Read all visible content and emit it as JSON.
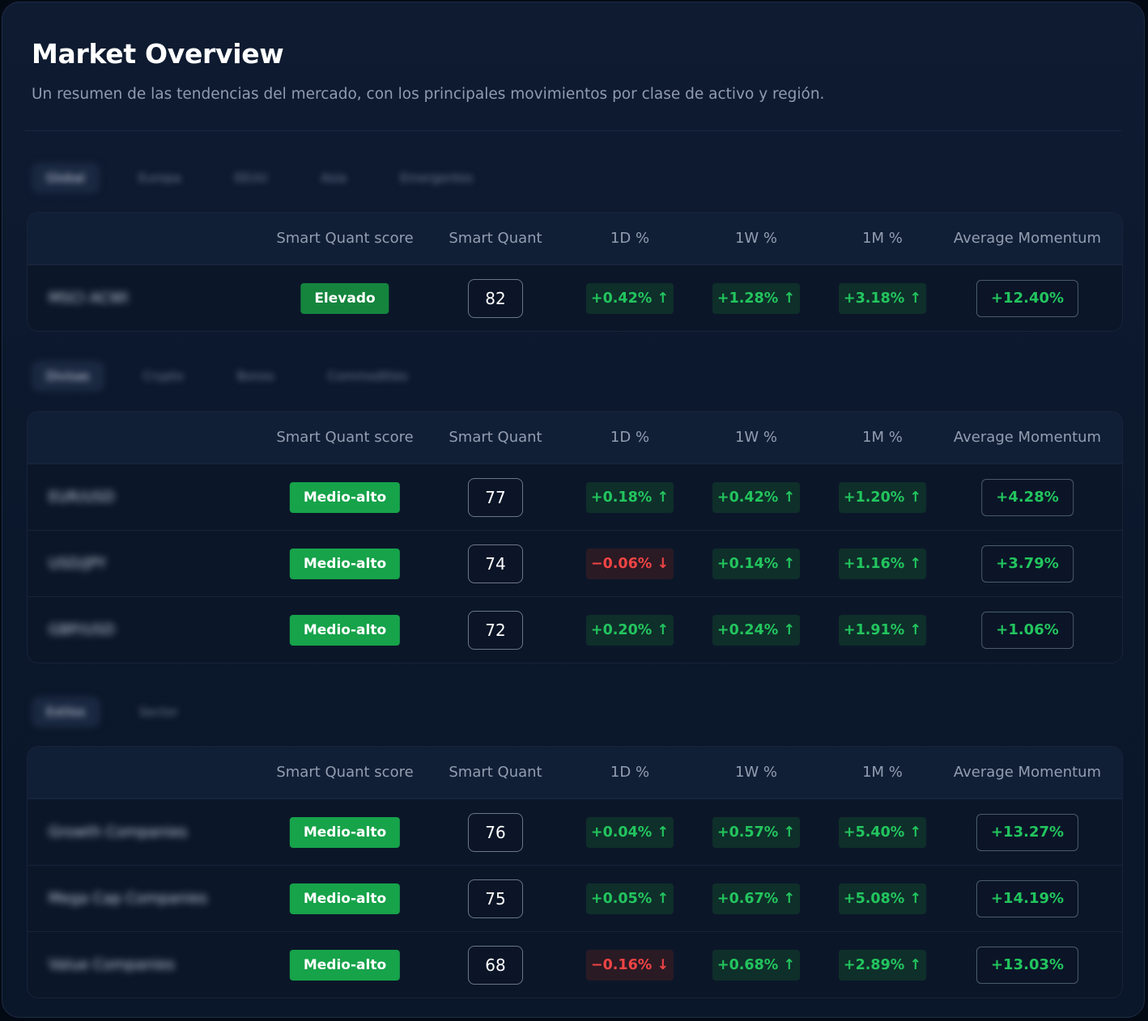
{
  "header": {
    "title": "Market Overview",
    "subtitle": "Un resumen de las tendencias del mercado, con los principales movimientos por clase de activo y región."
  },
  "columns": {
    "sq_score": "Smart Quant score",
    "sq": "Smart Quant",
    "d1": "1D %",
    "w1": "1W %",
    "m1": "1M %",
    "momentum": "Average Momentum"
  },
  "colors": {
    "accent_green": "#22c55e",
    "badge_green": "#16a34a",
    "negative_red": "#ef4444",
    "panel_bg": "#0b1729"
  },
  "sections": [
    {
      "tabs": [
        "Global",
        "Europa",
        "EEUU",
        "Asia",
        "Emergentes"
      ],
      "rows": [
        {
          "name": "MSCI ACWI",
          "score_label": "Elevado",
          "score": "82",
          "d1": "+0.42% ↑",
          "w1": "+1.28% ↑",
          "m1": "+3.18% ↑",
          "momentum": "+12.40%"
        }
      ]
    },
    {
      "tabs": [
        "Divisas",
        "Crypto",
        "Bonos",
        "Commodities"
      ],
      "rows": [
        {
          "name": "EUR/USD",
          "score_label": "Medio-alto",
          "score": "77",
          "d1": "+0.18% ↑",
          "w1": "+0.42% ↑",
          "m1": "+1.20% ↑",
          "momentum": "+4.28%"
        },
        {
          "name": "USD/JPY",
          "score_label": "Medio-alto",
          "score": "74",
          "d1": "−0.06% ↓",
          "w1": "+0.14% ↑",
          "m1": "+1.16% ↑",
          "momentum": "+3.79%"
        },
        {
          "name": "GBP/USD",
          "score_label": "Medio-alto",
          "score": "72",
          "d1": "+0.20% ↑",
          "w1": "+0.24% ↑",
          "m1": "+1.91% ↑",
          "momentum": "+1.06%"
        }
      ]
    },
    {
      "tabs": [
        "Estilos",
        "Sector"
      ],
      "rows": [
        {
          "name": "Growth Companies",
          "score_label": "Medio-alto",
          "score": "76",
          "d1": "+0.04% ↑",
          "w1": "+0.57% ↑",
          "m1": "+5.40% ↑",
          "momentum": "+13.27%"
        },
        {
          "name": "Mega Cap Companies",
          "score_label": "Medio-alto",
          "score": "75",
          "d1": "+0.05% ↑",
          "w1": "+0.67% ↑",
          "m1": "+5.08% ↑",
          "momentum": "+14.19%"
        },
        {
          "name": "Value Companies",
          "score_label": "Medio-alto",
          "score": "68",
          "d1": "−0.16% ↓",
          "w1": "+0.68% ↑",
          "m1": "+2.89% ↑",
          "momentum": "+13.03%"
        }
      ]
    }
  ]
}
